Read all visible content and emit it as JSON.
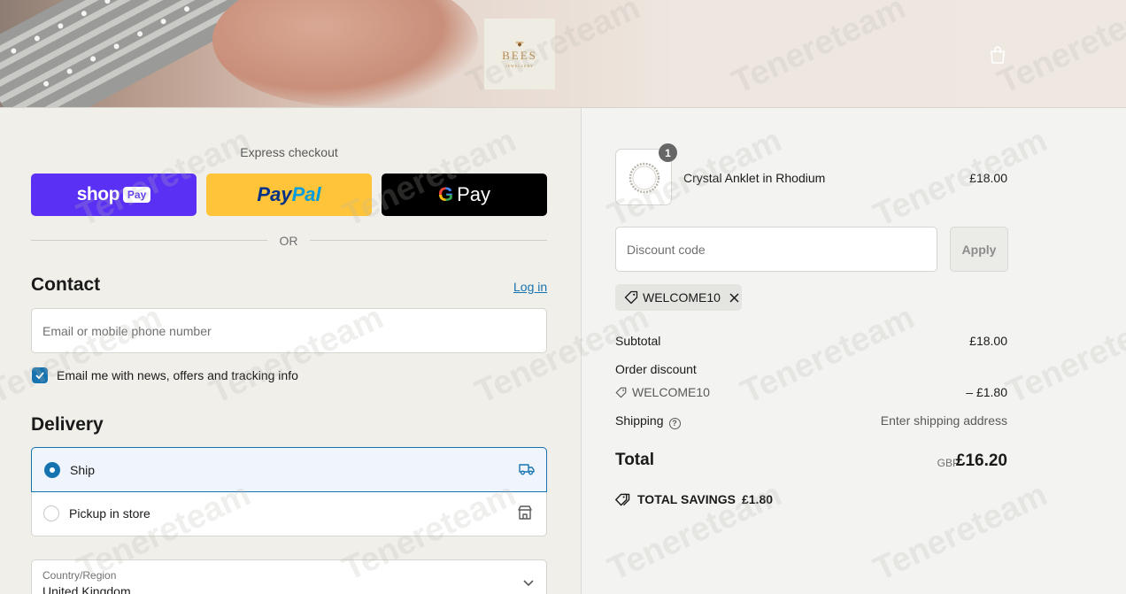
{
  "brand": {
    "name": "BEES",
    "tagline": "JEWELLERY"
  },
  "express": {
    "label": "Express checkout",
    "shop": "shop",
    "shop_tag": "Pay",
    "paypal_a": "Pay",
    "paypal_b": "Pal",
    "gpay_g": "G",
    "gpay": "Pay",
    "or": "OR"
  },
  "contact": {
    "heading": "Contact",
    "login": "Log in",
    "email_placeholder": "Email or mobile phone number",
    "newsletter_label": "Email me with news, offers and tracking info"
  },
  "delivery": {
    "heading": "Delivery",
    "options": [
      {
        "label": "Ship",
        "selected": true
      },
      {
        "label": "Pickup in store",
        "selected": false
      }
    ],
    "country_label": "Country/Region",
    "country_value": "United Kingdom"
  },
  "cart": {
    "item": {
      "name": "Crystal Anklet in Rhodium",
      "price": "£18.00",
      "quantity": "1"
    },
    "discount_placeholder": "Discount code",
    "apply": "Apply",
    "applied_code": "WELCOME10",
    "subtotal_label": "Subtotal",
    "subtotal": "£18.00",
    "order_discount_label": "Order discount",
    "discount_code": "WELCOME10",
    "discount_amount": "– £1.80",
    "shipping_label": "Shipping",
    "shipping_value": "Enter shipping address",
    "total_label": "Total",
    "currency": "GBP",
    "total": "£16.20",
    "savings_label": "TOTAL SAVINGS",
    "savings": "£1.80"
  },
  "watermark": "Tenereteam",
  "colors": {
    "accent": "#1773b0",
    "shop_pay": "#5a31f4",
    "paypal": "#ffc439",
    "gpay": "#000000"
  }
}
